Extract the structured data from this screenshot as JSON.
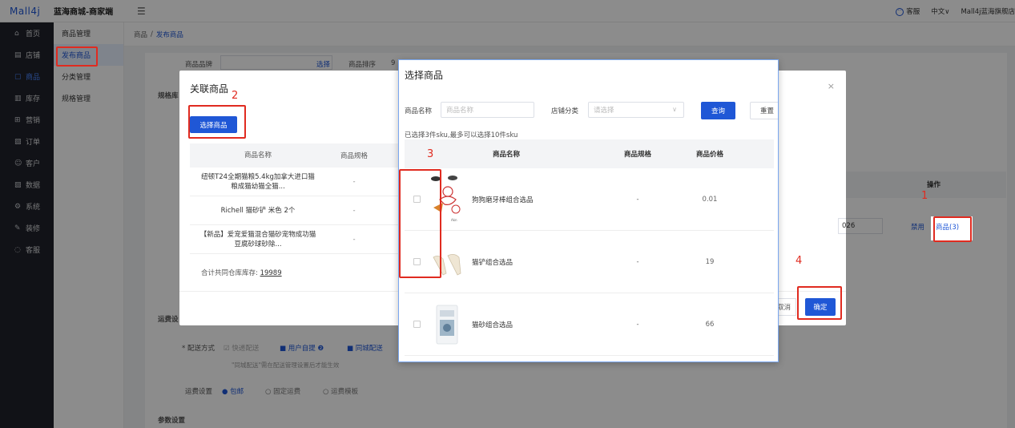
{
  "topbar": {
    "logo": "Mall4j",
    "shop_name": "蓝海商城-商家端",
    "menu_toggle": "☰",
    "customer_service": "客服",
    "language": "中文∨",
    "store_name": "Mall4j蓝海旗舰店"
  },
  "left_nav": [
    {
      "icon": "⌂",
      "label": "首页"
    },
    {
      "icon": "▤",
      "label": "店铺"
    },
    {
      "icon": "▢",
      "label": "商品"
    },
    {
      "icon": "▥",
      "label": "库存"
    },
    {
      "icon": "⊞",
      "label": "营销"
    },
    {
      "icon": "▧",
      "label": "订单"
    },
    {
      "icon": "☺",
      "label": "客户"
    },
    {
      "icon": "▨",
      "label": "数据"
    },
    {
      "icon": "⚙",
      "label": "系统"
    },
    {
      "icon": "✎",
      "label": "装修"
    },
    {
      "icon": "◌",
      "label": "客服"
    }
  ],
  "sub_nav": [
    "商品管理",
    "发布商品",
    "分类管理",
    "规格管理"
  ],
  "breadcrumb": {
    "root": "商品",
    "sep": "/",
    "current": "发布商品"
  },
  "background": {
    "brand_label": "商品品牌",
    "brand_select": "选择",
    "sort_label": "商品排序",
    "sort_value": "9",
    "spec_lib": "规格库",
    "shipping_section": "运费设",
    "delivery_label": "* 配送方式",
    "delivery_express": "快递配送",
    "delivery_pickup": "用户自提",
    "delivery_city": "同城配送",
    "delivery_note": "\"同城配送\"需在配送管理设置后才能生效",
    "freight_label": "运费设置",
    "freight_free": "包邮",
    "freight_fixed": "固定运费",
    "freight_template": "运费模板",
    "params_section": "参数设置",
    "ops_header": "操作",
    "row_value": "026",
    "row_disable": "禁用",
    "row_goods": "商品(3)"
  },
  "modal_related": {
    "title": "关联商品",
    "select_button": "选择商品",
    "columns": [
      "商品名称",
      "商品规格"
    ],
    "rows": [
      {
        "name": "纽顿T24全期猫粮5.4kg加拿大进口猫粮成猫幼猫全猫...",
        "spec": "-"
      },
      {
        "name": "Richell 猫砂铲 米色 2个",
        "spec": "-"
      },
      {
        "name": "【新品】爱宠爱猫混合猫砂宠物成功猫豆腐砂球砂除...",
        "spec": "-"
      }
    ],
    "total_label": "合计共同仓库库存: ",
    "total_value": "19989",
    "cancel": "取消",
    "confirm": "确定",
    "close": "×"
  },
  "modal_select": {
    "title": "选择商品",
    "name_label": "商品名称",
    "name_placeholder": "商品名称",
    "category_label": "店铺分类",
    "category_placeholder": "请选择",
    "query": "查询",
    "reset": "重置",
    "hint": "已选择3件sku,最多可以选择10件sku",
    "columns": [
      "商品名称",
      "商品规格",
      "商品价格"
    ],
    "rows": [
      {
        "name": "狗狗磨牙棒组合选品",
        "spec": "-",
        "price": "0.01"
      },
      {
        "name": "猫铲组合选品",
        "spec": "-",
        "price": "19"
      },
      {
        "name": "猫砂组合选品",
        "spec": "-",
        "price": "66"
      }
    ]
  },
  "annotations": [
    "1",
    "2",
    "3",
    "4"
  ],
  "colors": {
    "primary": "#1f57d6",
    "annotation": "#e02b20",
    "nav_bg": "#20222a"
  }
}
